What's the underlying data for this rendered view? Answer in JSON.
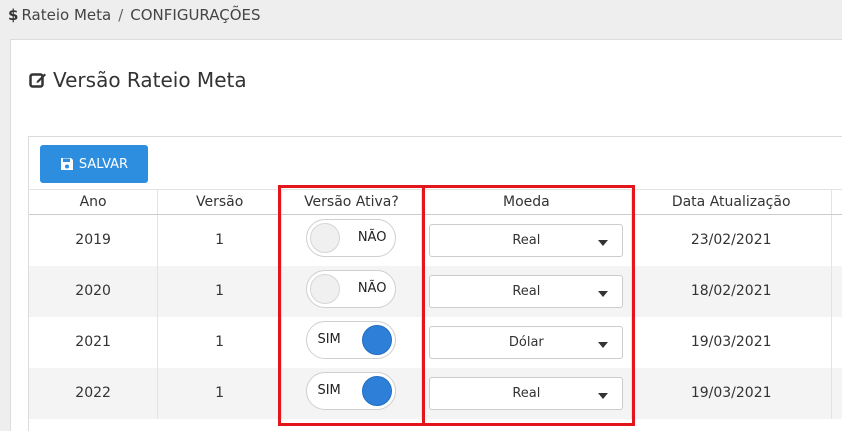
{
  "breadcrumb": {
    "root": "Rateio Meta",
    "current": "CONFIGURAÇÕES"
  },
  "page": {
    "title": "Versão Rateio Meta"
  },
  "toolbar": {
    "save_label": "SALVAR"
  },
  "table": {
    "headers": {
      "ano": "Ano",
      "versao": "Versão",
      "ativa": "Versão Ativa?",
      "moeda": "Moeda",
      "data": "Data Atualização"
    },
    "rows": [
      {
        "ano": "2019",
        "versao": "1",
        "ativa": "NÃO",
        "moeda": "Real",
        "data": "23/02/2021"
      },
      {
        "ano": "2020",
        "versao": "1",
        "ativa": "NÃO",
        "moeda": "Real",
        "data": "18/02/2021"
      },
      {
        "ano": "2021",
        "versao": "1",
        "ativa": "SIM",
        "moeda": "Dólar",
        "data": "19/03/2021"
      },
      {
        "ano": "2022",
        "versao": "1",
        "ativa": "SIM",
        "moeda": "Real",
        "data": "19/03/2021"
      }
    ]
  },
  "colors": {
    "accent": "#2d8ee0",
    "toggle_on": "#2d7fd8",
    "highlight": "#e3161b"
  }
}
